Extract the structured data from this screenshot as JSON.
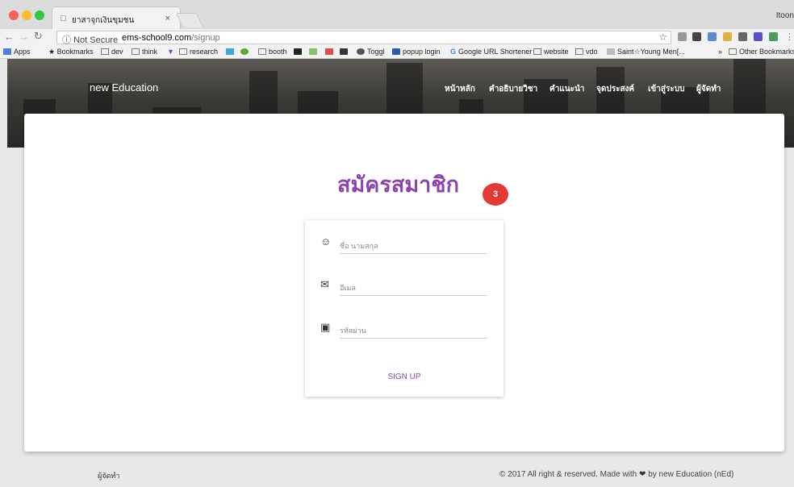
{
  "browser": {
    "tab_title": "ยาสาจุกเงินขุมชน",
    "tab_close": "×",
    "profile": "Itoon",
    "security_label": "Not Secure",
    "url_host": "ems-school9.com",
    "url_path": "/signup",
    "bookmarks": [
      "Apps",
      "Bookmarks",
      "dev",
      "think",
      "research",
      "booth",
      "Toggl",
      "popup login",
      "Google URL Shortener",
      "website",
      "vdo",
      "Saint☆Young Men[...",
      "»",
      "Other Bookmarks"
    ]
  },
  "site": {
    "brand": "new Education",
    "nav": [
      "หน้าหลัก",
      "คำอธิบายวิชา",
      "คำแนะนำ",
      "จุดประสงค์",
      "เข้าสู่ระบบ",
      "ผู้จัดทำ"
    ]
  },
  "signup": {
    "heading": "สมัครสมาชิก",
    "badge": "3",
    "name_placeholder": "ชื่อ นามสกุล",
    "email_placeholder": "อีเมล",
    "password_placeholder": "รหัสผ่าน",
    "button_label": "SIGN UP"
  },
  "footer": {
    "left": "ผู้จัดทำ",
    "right_prefix": "© 2017 All right & reserved. Made with",
    "right_suffix": "by new Education (nEd)"
  },
  "colors": {
    "accent": "#8e44ad",
    "badge": "#e53935"
  }
}
